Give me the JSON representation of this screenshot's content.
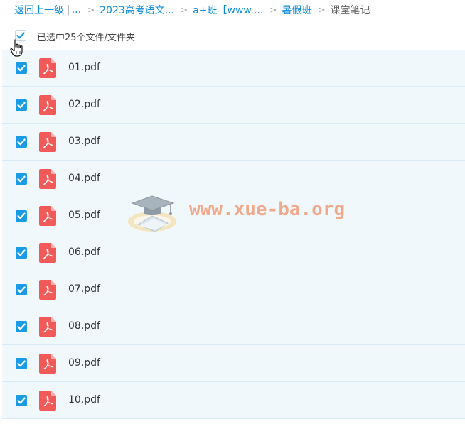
{
  "breadcrumb": {
    "back_label": "返回上一级",
    "pipe": "|",
    "ellipsis": "...",
    "separator": ">",
    "items": [
      "2023高考语文...",
      "a+班【www....",
      "暑假班"
    ],
    "current": "课堂笔记"
  },
  "selection": {
    "text": "已选中25个文件/文件夹",
    "all_checked": true
  },
  "files": [
    {
      "name": "01.pdf",
      "checked": true
    },
    {
      "name": "02.pdf",
      "checked": true
    },
    {
      "name": "03.pdf",
      "checked": true
    },
    {
      "name": "04.pdf",
      "checked": true
    },
    {
      "name": "05.pdf",
      "checked": true
    },
    {
      "name": "06.pdf",
      "checked": true
    },
    {
      "name": "07.pdf",
      "checked": true
    },
    {
      "name": "08.pdf",
      "checked": true
    },
    {
      "name": "09.pdf",
      "checked": true
    },
    {
      "name": "10.pdf",
      "checked": true
    }
  ],
  "watermark": {
    "text": "www.xue-ba.org"
  },
  "colors": {
    "link": "#0a8bd8",
    "checkbox": "#1a9be6",
    "pdf_icon": "#f25a5a",
    "row_background": "#f1f8fc",
    "row_border": "#d8eaf6",
    "watermark": "#f2a17f"
  },
  "icons": {
    "file_type": "pdf-icon",
    "checkbox": "checkmark-icon",
    "cursor": "hand-cursor-icon"
  }
}
